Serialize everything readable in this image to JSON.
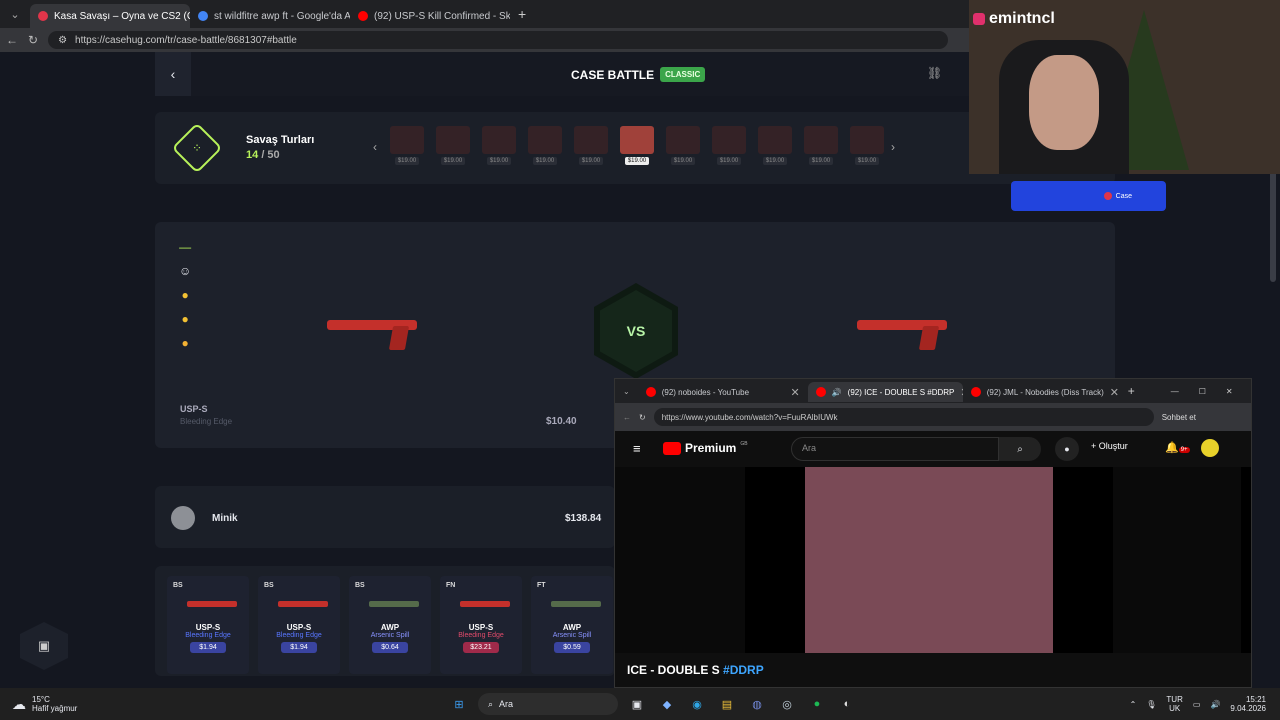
{
  "browser": {
    "tabs": [
      {
        "title": "Kasa Savaşı – Oyna ve CS2 (CS:GO",
        "active": true,
        "color": "#e0354a"
      },
      {
        "title": "st wildfitre awp ft - Google'da Ara",
        "active": false,
        "color": "#4285f4"
      },
      {
        "title": "(92) USP-S Kill Confirmed - Skin F",
        "active": false,
        "color": "#ff0000"
      }
    ],
    "url": "https://casehug.com/tr/case-battle/8681307#battle"
  },
  "header": {
    "title": "CASE BATTLE",
    "badge": "CLASSIC"
  },
  "rounds": {
    "label": "Savaş Turları",
    "current": "14",
    "total": "/ 50",
    "prices": [
      "$19.00",
      "$19.00",
      "$19.00",
      "$19.00",
      "$19.00",
      "$19.00",
      "$19.00",
      "$19.00",
      "$19.00",
      "$19.00",
      "$19.00"
    ]
  },
  "battle": {
    "vs": "VS",
    "left_item": {
      "name": "USP-S",
      "skin": "Bleeding Edge"
    },
    "price": "$10.40"
  },
  "player": {
    "name": "Minik",
    "total": "$138.84"
  },
  "items": [
    {
      "cond": "BS",
      "weapon": "USP-S",
      "skin": "Bleeding Edge",
      "price": "$1.94"
    },
    {
      "cond": "BS",
      "weapon": "USP-S",
      "skin": "Bleeding Edge",
      "price": "$1.94"
    },
    {
      "cond": "BS",
      "weapon": "AWP",
      "skin": "Arsenic Spill",
      "price": "$0.64"
    },
    {
      "cond": "FN",
      "weapon": "USP-S",
      "skin": "Bleeding Edge",
      "price": "$23.21"
    },
    {
      "cond": "FT",
      "weapon": "AWP",
      "skin": "Arsenic Spill",
      "price": "$0.59"
    }
  ],
  "stream": {
    "username": "emintncl",
    "sponsor": "Case"
  },
  "youtube": {
    "tabs": [
      {
        "title": "(92) noboides - YouTube"
      },
      {
        "title": "(92) ICE - DOUBLE S #DDRP"
      },
      {
        "title": "(92) JML - Nobodies (Diss Track)"
      }
    ],
    "url": "https://www.youtube.com/watch?v=FuuRAlbIUWk",
    "chat": "Sohbet et",
    "brand": "Premium",
    "brand_sup": "GB",
    "search_placeholder": "Ara",
    "create": "Oluştur",
    "notif": "9+",
    "video_title": "ICE - DOUBLE S",
    "video_tag": "#DDRP"
  },
  "taskbar": {
    "weather_temp": "15°C",
    "weather_text": "Hafif yağmur",
    "search": "Ara",
    "lang1": "TUR",
    "lang2": "UK",
    "time": "15:21",
    "date": "9.04.2026"
  }
}
